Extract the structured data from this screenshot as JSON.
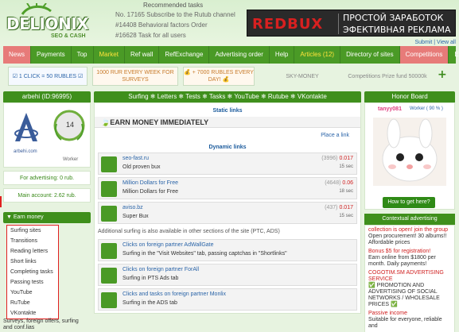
{
  "header": {
    "logo_text": "DELIONIX",
    "logo_sub": "SEO & CASH",
    "rec_title": "Recommended tasks",
    "rec_tasks": [
      "No. 17165 Subscribe to the Rutub channel",
      "#14408 Behavioral factors Order",
      "#16628 Task for all users"
    ],
    "banner_logo": "REDBUX",
    "banner_line1": "ПРОСТОЙ ЗАРАБОТОК",
    "banner_line2": "ЭФЕКТИВНАЯ РЕКЛАМА",
    "sub_links": "Submit | View all"
  },
  "nav": [
    {
      "label": "News",
      "style": "news"
    },
    {
      "label": "Payments",
      "style": ""
    },
    {
      "label": "Top",
      "style": ""
    },
    {
      "label": "Market",
      "style": "yellow"
    },
    {
      "label": "Ref wall",
      "style": ""
    },
    {
      "label": "RefExchange",
      "style": ""
    },
    {
      "label": "Advertising order",
      "style": ""
    },
    {
      "label": "Help",
      "style": ""
    },
    {
      "label": "Articles (12)",
      "style": "yellow"
    },
    {
      "label": "Directory of sites",
      "style": ""
    },
    {
      "label": "Competitions",
      "style": "comp"
    },
    {
      "label": "Exit",
      "style": ""
    }
  ],
  "promo": {
    "box1": "☑ 1 CLICK = 50 RUBLES ☑",
    "box2": "1000 RUR EVERY WEEK FOR SURVEYS",
    "box3": "💰 + 7000 RUBLES EVERY DAY! 💰",
    "box4": "SKY-MONEY",
    "box5": "Competitions Prize fund 50000k",
    "plus": "+"
  },
  "user": {
    "name": "arbehi (ID:96995)",
    "site": "arbehi.com",
    "level": "14",
    "role": "Worker",
    "advertising": "For advertising: 0 rub.",
    "main_account": "Main account: 2.62 rub."
  },
  "earn_menu": {
    "title": "Earn money",
    "items": [
      "Surfing sites",
      "Transitions",
      "Reading letters",
      "Short links",
      "Completing tasks",
      "Passing tests",
      "YouTube",
      "RuTube",
      "VKontakte"
    ],
    "footer": "Surveys, foreign offers, surfing and conf.lias"
  },
  "center": {
    "header": "Surfing ❄ Letters ❄ Tests ❄ Tasks ❄ YouTube ❄ Rutube ❄ VKontakte",
    "static_title": "Static links",
    "earn_now": "EARN MONEY IMMEDIATELY",
    "place_link": "Place a link",
    "dynamic_title": "Dynamic links",
    "links": [
      {
        "title": "seo-fast.ru",
        "subtitle": "Old proven bux",
        "count": "(3996)",
        "price": "0.017",
        "time": "15 sec"
      },
      {
        "title": "Million Dollars for Free",
        "subtitle": "Million Dollars for Free",
        "count": "(4648)",
        "price": "0.06",
        "time": "18 sec"
      },
      {
        "title": "aviso.bz",
        "subtitle": "Super Bux",
        "count": "(437)",
        "price": "0.017",
        "time": "15 sec"
      }
    ],
    "also_text": "Additional surfing is also available in other sections of the site (PTC, ADS)",
    "extra": [
      {
        "title": "Clicks on foreign partner AdWallGate",
        "subtitle": "Surfing in the \"Visit Websites\" tab, passing captchas in \"Shortlinks\""
      },
      {
        "title": "Clicks on foreign partner ForAll",
        "subtitle": "Surfing in PTS Ads tab"
      },
      {
        "title": "Clicks and tasks on foreign partner Monlix",
        "subtitle": "Surfing in the ADS tab"
      }
    ]
  },
  "honor": {
    "title": "Honor Board",
    "user": "tanyy081",
    "role": "Worker ( 90 % )",
    "button": "How to get here?"
  },
  "context": {
    "title": "Contextual advertising",
    "ads": [
      {
        "link": "collection is open! join the group",
        "text": "Open procurement! 30 albums!! Affordable prices"
      },
      {
        "link": "Bonus $5 for registration!",
        "text": "Earn online from $1800 per month. Daily payments!"
      },
      {
        "link": "COGOTIM.SM ADVERTISING SERVICE",
        "text": "✅ PROMOTION AND ADVERTISING OF SOCIAL NETWORKS / WHOLESALE PRICES ✅"
      },
      {
        "link": "Passive income",
        "text": "Suitable for everyone, reliable and"
      }
    ]
  },
  "colors": {
    "nav_green": "#4a9a26",
    "news_red": "#e77b79",
    "link_blue": "#2a64a8",
    "price_red": "#d02020"
  }
}
